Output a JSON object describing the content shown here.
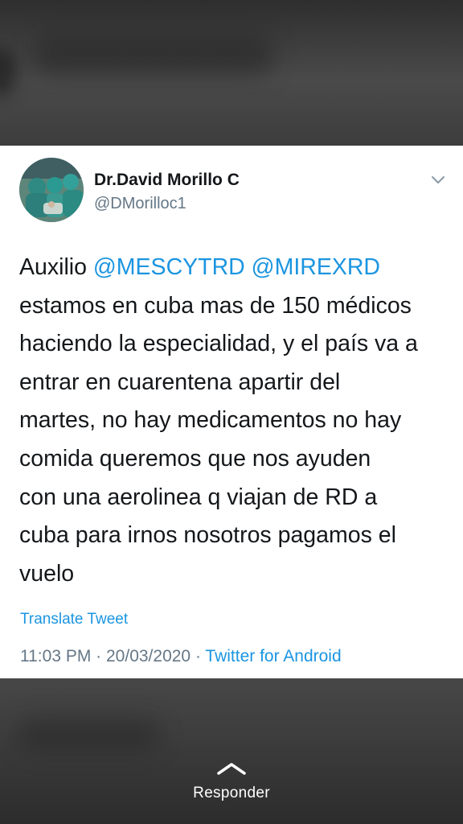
{
  "tweet": {
    "author_name": "Dr.David Morillo C",
    "author_handle": "@DMorilloc1",
    "text_parts": [
      {
        "type": "text",
        "value": "Auxilio "
      },
      {
        "type": "mention",
        "value": "@MESCYTRD"
      },
      {
        "type": "text",
        "value": " "
      },
      {
        "type": "mention",
        "value": "@MIREXRD"
      },
      {
        "type": "text",
        "value": "\nestamos en cuba mas de 150 médicos\nhaciendo la especialidad, y el país va a\nentrar en cuarentena apartir del\nmartes,  no hay medicamentos no hay\ncomida queremos que nos ayuden\ncon una aerolinea q viajan de RD a\ncuba para irnos nosotros pagamos el\nvuelo"
      }
    ],
    "translate_label": "Translate Tweet",
    "time": "11:03 PM",
    "separator": " · ",
    "date": "20/03/2020",
    "source": "Twitter for Android"
  },
  "footer": {
    "reply_label": "Responder"
  },
  "icons": {
    "menu": "chevron-down-icon",
    "reply": "chevron-up-icon"
  },
  "colors": {
    "link": "#1b95e0",
    "text": "#14171a",
    "secondary": "#657786"
  }
}
